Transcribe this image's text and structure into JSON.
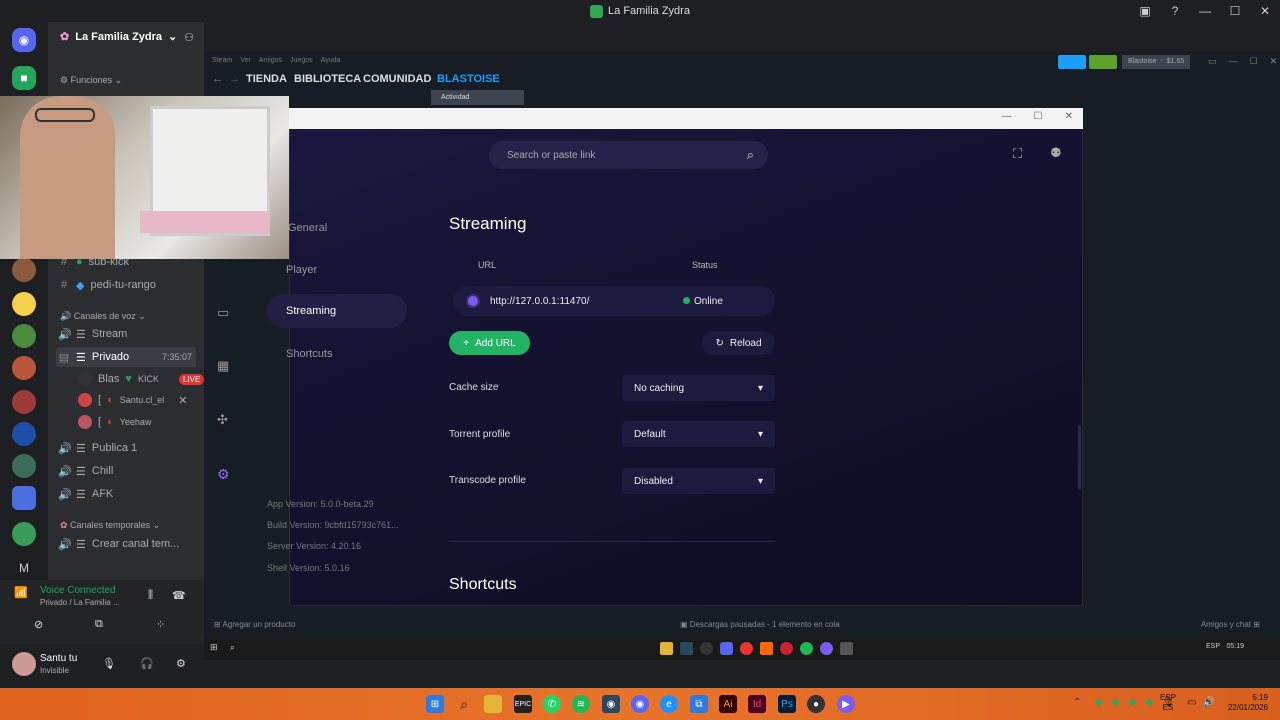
{
  "window_title": "La Familia Zydra",
  "discord": {
    "server_name": "La Familia Zydra",
    "funciones": "Funciones",
    "channels": {
      "sub_kick": "sub-kick",
      "pedi_tu_rango": "pedi-tu-rango",
      "voice_category": "Canales de voz",
      "stream": "Stream",
      "privado": "Privado",
      "privado_time": "7:35:07",
      "publica": "Publica 1",
      "chill": "Chill",
      "afk": "AFK",
      "temp_category": "Canales temporales",
      "crear": "Crear canal tem..."
    },
    "voice_users": [
      {
        "name": "Blas",
        "tag": "KICK",
        "badge": "LIVE"
      },
      {
        "name": "Santu.cl_el"
      },
      {
        "name": "Yeehaw"
      }
    ],
    "voice_connected": "Voice Connected",
    "voice_path": "Privado / La Familia ...",
    "user": {
      "name": "Santu tu",
      "status": "Invisible"
    }
  },
  "steam": {
    "menu": [
      "Steam",
      "Ver",
      "Amigos",
      "Juegos",
      "Ayuda"
    ],
    "nav": {
      "tienda": "TIENDA",
      "biblioteca": "BIBLIOTECA",
      "comunidad": "COMUNIDAD",
      "user": "BLASTOISE"
    },
    "tooltip": "Actividad",
    "account": "Blastoise",
    "balance": "$1.65",
    "status_left": "Agregar un producto",
    "status_mid": "Descargas pausadas - 1 elemento en cola",
    "status_right": "Amigos y chat"
  },
  "stremio": {
    "search_placeholder": "Search or paste link",
    "sidebar": {
      "general": "General",
      "player": "Player",
      "streaming": "Streaming",
      "shortcuts": "Shortcuts"
    },
    "section_title": "Streaming",
    "col_url": "URL",
    "col_status": "Status",
    "url_value": "http://127.0.0.1:11470/",
    "status_value": "Online",
    "add_url": "Add URL",
    "reload": "Reload",
    "cache_label": "Cache size",
    "cache_value": "No caching",
    "torrent_label": "Torrent profile",
    "torrent_value": "Default",
    "transcode_label": "Transcode profile",
    "transcode_value": "Disabled",
    "versions": {
      "app": "App Version: 5.0.0-beta.29",
      "build": "Build Version: 9cbfd15793c761...",
      "server": "Server Version: 4.20.16",
      "shell": "Shell Version: 5.0.16"
    },
    "shortcuts_title": "Shortcuts"
  },
  "inner_tray": {
    "lang": "ESP",
    "time": "05:19"
  },
  "taskbar": {
    "lang1": "ESP",
    "lang2": "ES",
    "time": "5:19",
    "date": "22/01/2026"
  },
  "colors": {
    "accent_green": "#22b365",
    "stremio_purple": "#7b5bf2",
    "live_red": "#e03434",
    "taskbar": "#e8742b"
  }
}
